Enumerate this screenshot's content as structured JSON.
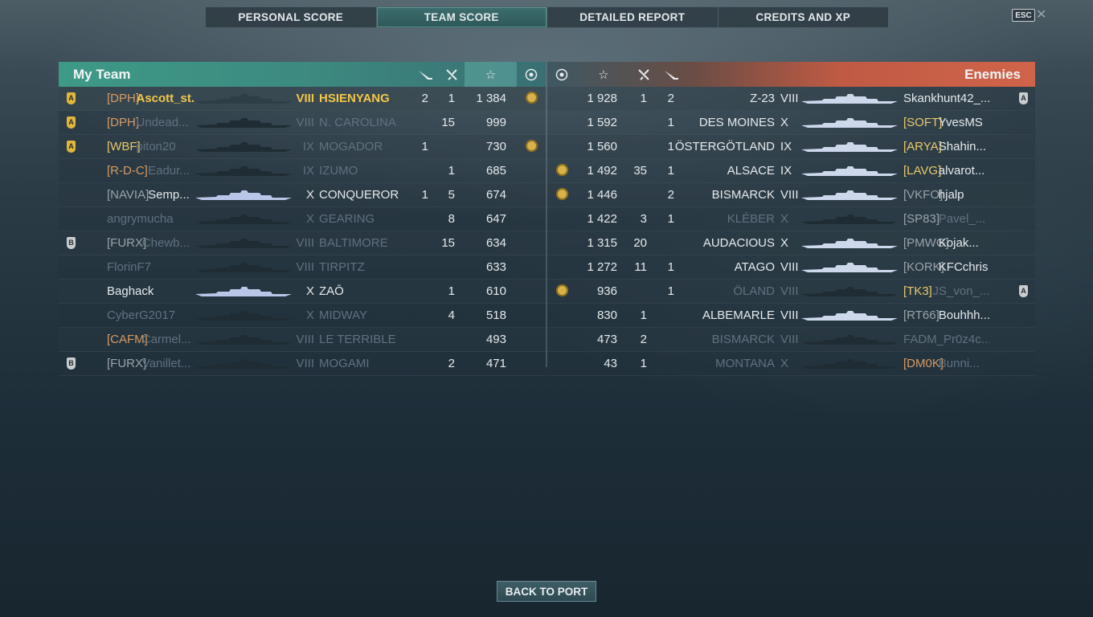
{
  "tabs": [
    "PERSONAL SCORE",
    "TEAM SCORE",
    "DETAILED REPORT",
    "CREDITS AND XP"
  ],
  "active_tab": "TEAM SCORE",
  "esc_label": "ESC",
  "close_glyph": "✕",
  "my_team": {
    "title": "My Team",
    "header_icons": [
      "torpedo-icon",
      "plane-icon",
      "star-icon",
      "medal-icon"
    ],
    "rows": [
      {
        "rank": "A",
        "clan": "[DPH]",
        "name": "Ascott_st...",
        "tier": "VIII",
        "ship": "HSIENYANG",
        "c1": "2",
        "c2": "1",
        "score": "1 384",
        "medal": true,
        "me": true,
        "state": "me",
        "clan_color": "o"
      },
      {
        "rank": "A",
        "clan": "[DPH]",
        "name": "Undead...",
        "tier": "VIII",
        "ship": "N. CAROLINA",
        "c1": "",
        "c2": "15",
        "score": "999",
        "medal": false,
        "state": "dead",
        "clan_color": "o"
      },
      {
        "rank": "A",
        "clan": "[WBF]",
        "name": "piton20",
        "tier": "IX",
        "ship": "MOGADOR",
        "c1": "1",
        "c2": "",
        "score": "730",
        "medal": true,
        "state": "dead",
        "clan_color": "y"
      },
      {
        "rank": "",
        "clan": "[R-D-C]",
        "name": "Eadur...",
        "tier": "IX",
        "ship": "IZUMO",
        "c1": "",
        "c2": "1",
        "score": "685",
        "medal": false,
        "state": "dead",
        "clan_color": "o"
      },
      {
        "rank": "",
        "clan": "[NAVIA]",
        "name": "Semp...",
        "tier": "X",
        "ship": "CONQUEROR",
        "c1": "1",
        "c2": "5",
        "score": "674",
        "medal": false,
        "state": "alive",
        "clan_color": "g"
      },
      {
        "rank": "",
        "clan": "",
        "name": "angrymucha",
        "tier": "X",
        "ship": "GEARING",
        "c1": "",
        "c2": "8",
        "score": "647",
        "medal": false,
        "state": "dead",
        "clan_color": "g"
      },
      {
        "rank": "B",
        "clan": "[FURX]",
        "name": "Chewb...",
        "tier": "VIII",
        "ship": "BALTIMORE",
        "c1": "",
        "c2": "15",
        "score": "634",
        "medal": false,
        "state": "dead",
        "clan_color": "g"
      },
      {
        "rank": "",
        "clan": "",
        "name": "FlorinF7",
        "tier": "VIII",
        "ship": "TIRPITZ",
        "c1": "",
        "c2": "",
        "score": "633",
        "medal": false,
        "state": "dead",
        "clan_color": "g"
      },
      {
        "rank": "",
        "clan": "",
        "name": "Baghack",
        "tier": "X",
        "ship": "ZAŌ",
        "c1": "",
        "c2": "1",
        "score": "610",
        "medal": false,
        "state": "alive",
        "clan_color": "g"
      },
      {
        "rank": "",
        "clan": "",
        "name": "CyberG2017",
        "tier": "X",
        "ship": "MIDWAY",
        "c1": "",
        "c2": "4",
        "score": "518",
        "medal": false,
        "state": "dead",
        "clan_color": "g"
      },
      {
        "rank": "",
        "clan": "[CAFM]",
        "name": "Carmel...",
        "tier": "VIII",
        "ship": "LE TERRIBLE",
        "c1": "",
        "c2": "",
        "score": "493",
        "medal": false,
        "state": "dead",
        "clan_color": "o"
      },
      {
        "rank": "B",
        "clan": "[FURX]",
        "name": "Vanillet...",
        "tier": "VIII",
        "ship": "MOGAMI",
        "c1": "",
        "c2": "2",
        "score": "471",
        "medal": false,
        "state": "dead",
        "clan_color": "g"
      }
    ]
  },
  "enemies": {
    "title": "Enemies",
    "rows": [
      {
        "medal": false,
        "score": "1 928",
        "c2": "1",
        "c1": "2",
        "ship": "Z-23",
        "tier": "VIII",
        "clan": "",
        "name": "Skankhunt42_...",
        "rank": "A",
        "state": "alive",
        "clan_color": "g"
      },
      {
        "medal": false,
        "score": "1 592",
        "c2": "",
        "c1": "1",
        "ship": "DES MOINES",
        "tier": "X",
        "clan": "[SOFT]",
        "name": "YvesMS",
        "rank": "",
        "state": "alive",
        "clan_color": "y"
      },
      {
        "medal": false,
        "score": "1 560",
        "c2": "",
        "c1": "1",
        "ship": "ÖSTERGÖTLAND",
        "tier": "IX",
        "clan": "[ARYA]",
        "name": "Shahin...",
        "rank": "",
        "state": "alive",
        "clan_color": "y"
      },
      {
        "medal": true,
        "score": "1 492",
        "c2": "35",
        "c1": "1",
        "ship": "ALSACE",
        "tier": "IX",
        "clan": "[LAVG]",
        "name": "alvarot...",
        "rank": "",
        "state": "alive",
        "clan_color": "y"
      },
      {
        "medal": true,
        "score": "1 446",
        "c2": "",
        "c1": "2",
        "ship": "BISMARCK",
        "tier": "VIII",
        "clan": "[VKFO]",
        "name": "hjalp",
        "rank": "",
        "state": "alive",
        "clan_color": "g"
      },
      {
        "medal": false,
        "score": "1 422",
        "c2": "3",
        "c1": "1",
        "ship": "KLÉBER",
        "tier": "X",
        "clan": "[SP83]",
        "name": "Pavel_...",
        "rank": "",
        "state": "dead",
        "clan_color": "g"
      },
      {
        "medal": false,
        "score": "1 315",
        "c2": "20",
        "c1": "",
        "ship": "AUDACIOUS",
        "tier": "X",
        "clan": "[PMWG]",
        "name": "Kojak...",
        "rank": "",
        "state": "alive",
        "clan_color": "g"
      },
      {
        "medal": false,
        "score": "1 272",
        "c2": "11",
        "c1": "1",
        "ship": "ATAGO",
        "tier": "VIII",
        "clan": "[KORK]",
        "name": "KFCchris",
        "rank": "",
        "state": "alive",
        "clan_color": "g"
      },
      {
        "medal": true,
        "score": "936",
        "c2": "",
        "c1": "1",
        "ship": "ÖLAND",
        "tier": "VIII",
        "clan": "[TK3]",
        "name": "JS_von_...",
        "rank": "A",
        "state": "dead",
        "clan_color": "y"
      },
      {
        "medal": false,
        "score": "830",
        "c2": "1",
        "c1": "",
        "ship": "ALBEMARLE",
        "tier": "VIII",
        "clan": "[RT66]",
        "name": "Bouhhh...",
        "rank": "",
        "state": "alive",
        "clan_color": "g"
      },
      {
        "medal": false,
        "score": "473",
        "c2": "2",
        "c1": "",
        "ship": "BISMARCK",
        "tier": "VIII",
        "clan": "",
        "name": "FADM_Pr0z4c...",
        "rank": "",
        "state": "dead",
        "clan_color": "g"
      },
      {
        "medal": false,
        "score": "43",
        "c2": "1",
        "c1": "",
        "ship": "MONTANA",
        "tier": "X",
        "clan": "[DM0K]",
        "name": "Bunni...",
        "rank": "",
        "state": "dead",
        "clan_color": "o"
      }
    ]
  },
  "back_button": "BACK TO PORT",
  "colors": {
    "ally_header": "#3d9a86",
    "enemy_header": "#d0644a",
    "highlight": "#f3c64a"
  }
}
